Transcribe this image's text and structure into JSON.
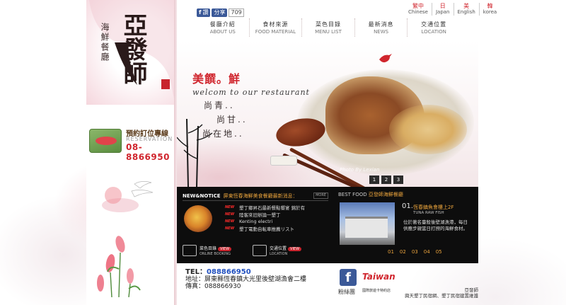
{
  "brand": {
    "name_main": "亞發師",
    "name_sub": "海鮮餐廳"
  },
  "reservation": {
    "title": "預約訂位專線",
    "subtitle": "RESERVATION",
    "phone": "08-8866950"
  },
  "share": {
    "like_label": "讚",
    "share_label": "分享",
    "count": "709"
  },
  "languages": [
    {
      "top": "繁中",
      "bottom": "Chinese"
    },
    {
      "top": "日",
      "bottom": "Japan"
    },
    {
      "top": "美",
      "bottom": "English"
    },
    {
      "top": "韓",
      "bottom": "korea"
    }
  ],
  "nav": [
    {
      "zh": "餐廳介紹",
      "en": "ABOUT US"
    },
    {
      "zh": "食材來源",
      "en": "FOOD MATERIAL"
    },
    {
      "zh": "菜色目錄",
      "en": "MENU LIST"
    },
    {
      "zh": "最新消息",
      "en": "NEWS"
    },
    {
      "zh": "交通位置",
      "en": "LOCATION"
    }
  ],
  "banner": {
    "slogan": "美饌。鮮",
    "welcome": "welcom to our restaurant",
    "line1": "尚青..",
    "line2": "尚甘..",
    "line3": "尚在地..",
    "photo_credit": "Photo By Lexian",
    "slides": [
      "1",
      "2",
      "3"
    ]
  },
  "news": {
    "tag": "NEW&NOTICE",
    "headline": "屏東恆春海鮮美食餐廳最新消息：",
    "more": "MORE",
    "new_label": "NEW",
    "items": [
      "墾丁鄉昇石最新餐點饗宴 錦於有",
      "陸客來旧辦論一墾丁",
      "Kenting electri",
      "墾丁電動自転車推薦リスト"
    ],
    "actions": [
      {
        "label": "菜色目錄",
        "sub": "ONLINE BOOKING",
        "view": "VIEW"
      },
      {
        "label": "交通位置",
        "sub": "LOCATION",
        "view": "VIEW"
      }
    ]
  },
  "bestfood": {
    "head_en": "BEST FOOD",
    "head_zh": "亞發師海鮮餐廳",
    "num": "01.",
    "title": "恆春鎮魚會樓上2F",
    "sub": "TUNA RAW FISH",
    "desc": "位於著名臺殺後壁湖漁港，每日供應步親當日打撈的海鮮食材。",
    "pager": [
      "01",
      "02",
      "03",
      "04",
      "05"
    ]
  },
  "footer": {
    "tel_label": "TEL：",
    "tel": "088866950",
    "addr": "地址：屏東縣恆春鎮大光里後壁湖漁會二樓",
    "fax": "傳真：088866930",
    "fb_label": "粉絲團",
    "tc_label": "國際旅遊卡特約店",
    "right1": "亞發師",
    "right2": "興天墾丁民宿網、墾丁民宿建置維護"
  },
  "colors": {
    "accent": "#d0262e",
    "gold": "#e8a23c",
    "dark_panel": "#0d0d0d",
    "facebook": "#3b5998"
  }
}
